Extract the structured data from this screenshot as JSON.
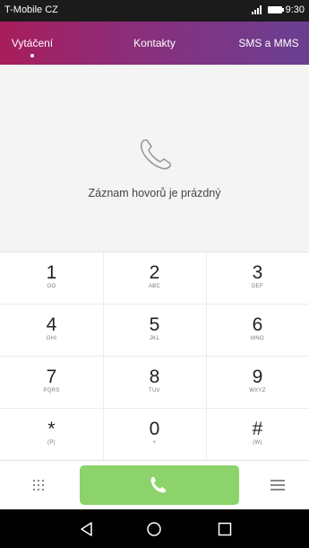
{
  "status_bar": {
    "carrier": "T-Mobile CZ",
    "time": "9:30"
  },
  "tabs": [
    {
      "label": "Vytáčení"
    },
    {
      "label": "Kontakty"
    },
    {
      "label": "SMS a MMS"
    }
  ],
  "call_log": {
    "empty_message": "Záznam hovorů je prázdný",
    "icon": "phone-icon"
  },
  "keypad": [
    {
      "digit": "1",
      "sub": "OO"
    },
    {
      "digit": "2",
      "sub": "ABC"
    },
    {
      "digit": "3",
      "sub": "DEF"
    },
    {
      "digit": "4",
      "sub": "GHI"
    },
    {
      "digit": "5",
      "sub": "JKL"
    },
    {
      "digit": "6",
      "sub": "MNO"
    },
    {
      "digit": "7",
      "sub": "PQRS"
    },
    {
      "digit": "8",
      "sub": "TUV"
    },
    {
      "digit": "9",
      "sub": "WXYZ"
    },
    {
      "digit": "*",
      "sub": "(P)"
    },
    {
      "digit": "0",
      "sub": "+"
    },
    {
      "digit": "#",
      "sub": "(W)"
    }
  ],
  "colors": {
    "tab_gradient_start": "#a81d5c",
    "tab_gradient_end": "#6a3f92",
    "call_button": "#8cd36c"
  }
}
